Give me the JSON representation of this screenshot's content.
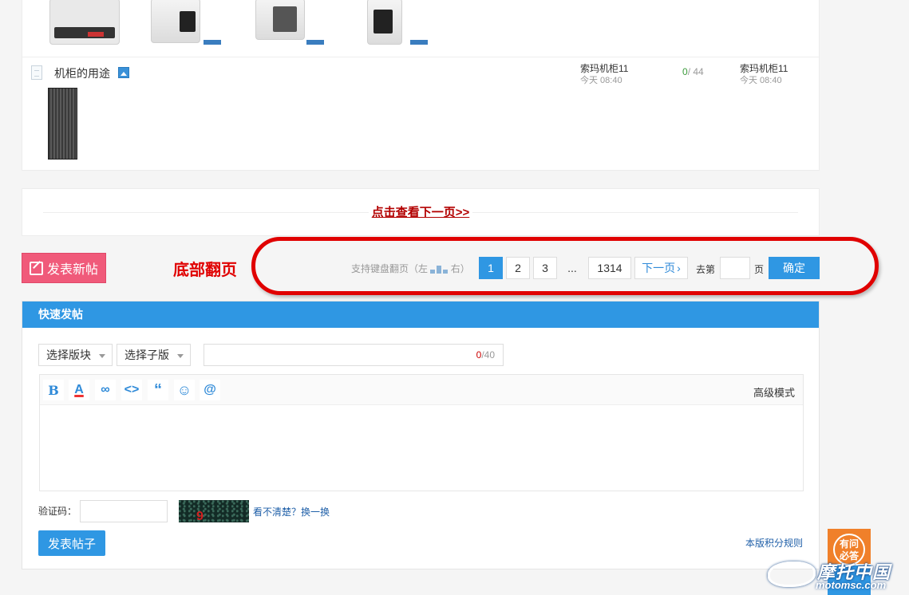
{
  "thread": {
    "title": "机柜的用途",
    "author": "索玛机柜11",
    "time": "今天 08:40",
    "replies": "0",
    "views": "/ 44",
    "last_poster": "索玛机柜11",
    "last_time": "今天 08:40"
  },
  "next_page_link": "点击查看下一页>>",
  "new_post_label": "发表新帖",
  "annotation": "底部翻页",
  "pager": {
    "hint_prefix": "支持键盘翻页（左",
    "hint_suffix": "右）",
    "pages": [
      "1",
      "2",
      "3"
    ],
    "dots": "...",
    "last_page": "1314",
    "next_label": "下一页",
    "goto_prefix": "去第",
    "goto_suffix": "页",
    "confirm_label": "确定"
  },
  "quick_post": {
    "title": "快速发帖",
    "board_select": "选择版块",
    "sub_board_select": "选择子版",
    "title_count_current": "0",
    "title_count_max": "/40",
    "advanced_mode": "高级模式",
    "captcha_label": "验证码：",
    "captcha_text": "9 +12",
    "captcha_refresh": "看不清楚？换一换",
    "submit_label": "发表帖子",
    "rules_link": "本版积分规则"
  },
  "help_widget": {
    "line1": "有问",
    "line2": "必答"
  },
  "watermark": {
    "main": "摩托中国",
    "sub": "motomsc.com"
  },
  "colors": {
    "primary": "#2f97e3",
    "new_post": "#f05a7a",
    "annotation_red": "#e00000",
    "link_red": "#b30000"
  },
  "toolbar_icons": [
    "bold-icon",
    "font-color-icon",
    "link-icon",
    "code-icon",
    "quote-icon",
    "emoji-icon",
    "mention-icon"
  ]
}
